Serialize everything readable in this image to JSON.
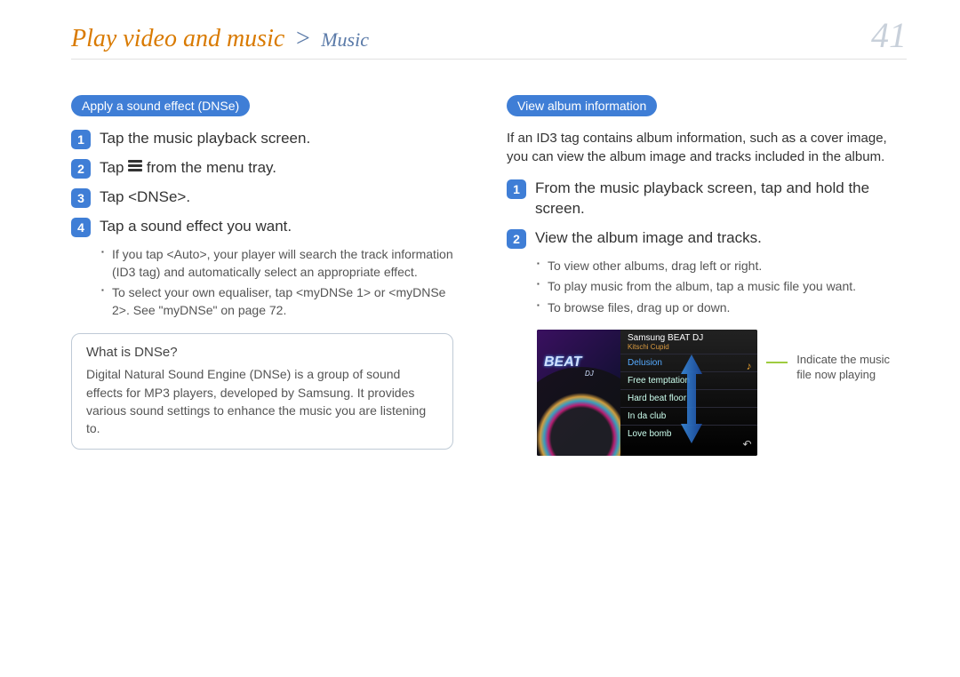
{
  "breadcrumb": {
    "main": "Play video and music",
    "sep": ">",
    "sub": "Music"
  },
  "page_number": "41",
  "left": {
    "section_tag": "Apply a sound effect (DNSe)",
    "steps": [
      {
        "n": "1",
        "text": "Tap the music playback screen."
      },
      {
        "n": "2",
        "text_pre": "Tap ",
        "text_post": " from the menu tray."
      },
      {
        "n": "3",
        "text": "Tap <DNSe>."
      },
      {
        "n": "4",
        "text": "Tap a sound effect you want."
      }
    ],
    "sub_bullets": [
      "If you tap <Auto>, your player will search the track information (ID3 tag) and automatically select an appropriate effect.",
      "To select your own equaliser, tap <myDNSe 1> or <myDNSe 2>. See \"myDNSe\" on page 72."
    ],
    "info_box": {
      "q": "What is DNSe?",
      "a": "Digital Natural Sound Engine (DNSe) is a group of sound effects for MP3 players, developed by Samsung. It provides various sound settings to enhance the music you are listening to."
    }
  },
  "right": {
    "section_tag": "View album information",
    "intro": "If an ID3 tag contains album information, such as a cover image, you can view the album image and tracks included in the album.",
    "steps": [
      {
        "n": "1",
        "text": "From the music playback screen, tap and hold the screen."
      },
      {
        "n": "2",
        "text": "View the album image and tracks."
      }
    ],
    "sub_bullets": [
      "To view other albums, drag left or right.",
      "To play music from the album, tap a music file you want.",
      "To browse files, drag up or down."
    ],
    "device": {
      "brand": "BEAT",
      "brand_sub": "DJ",
      "title": "Samsung BEAT DJ",
      "subtitle": "Kitschi Cupid",
      "tracks": [
        "Delusion",
        "Free temptation",
        "Hard beat floor",
        "In da club",
        "Love bomb"
      ]
    },
    "callout": "Indicate the music file now playing"
  }
}
